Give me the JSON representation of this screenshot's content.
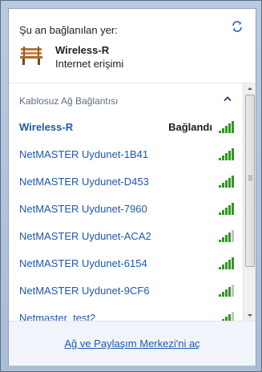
{
  "header": {
    "title": "Şu an bağlanılan yer:",
    "connection_name": "Wireless-R",
    "connection_status": "Internet erişimi",
    "refresh_icon": "refresh-icon",
    "network_icon": "bench-icon"
  },
  "section": {
    "label": "Kablosuz Ağ Bağlantısı",
    "toggle_icon": "chevron-up-icon"
  },
  "networks": [
    {
      "name": "Wireless-R",
      "state": "Bağlandı",
      "signal_bars": 5
    },
    {
      "name": "NetMASTER Uydunet-1B41",
      "state": "",
      "signal_bars": 5
    },
    {
      "name": "NetMASTER Uydunet-D453",
      "state": "",
      "signal_bars": 5
    },
    {
      "name": "NetMASTER Uydunet-7960",
      "state": "",
      "signal_bars": 5
    },
    {
      "name": "NetMASTER Uydunet-ACA2",
      "state": "",
      "signal_bars": 4
    },
    {
      "name": "NetMASTER Uydunet-6154",
      "state": "",
      "signal_bars": 5
    },
    {
      "name": "NetMASTER Uydunet-9CF6",
      "state": "",
      "signal_bars": 4
    },
    {
      "name": "Netmaster_test2",
      "state": "",
      "signal_bars": 4
    }
  ],
  "footer": {
    "link": "Ağ ve Paylaşım Merkezi'ni aç"
  },
  "colors": {
    "link": "#1d57b3",
    "signal": "#2e9a1e",
    "signal_empty": "#c4c4c4"
  }
}
